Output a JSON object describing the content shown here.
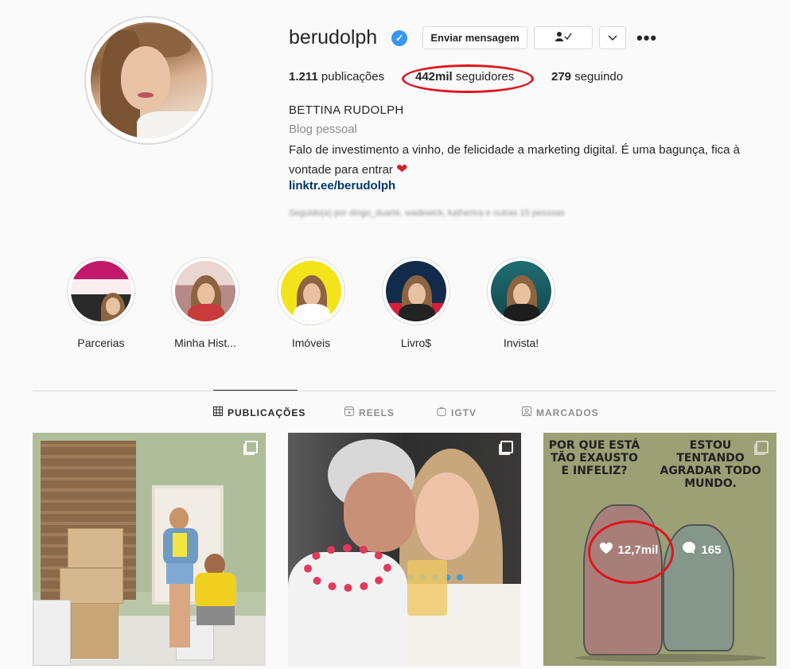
{
  "profile": {
    "username": "berudolph",
    "verified_icon": "verified-badge-icon",
    "buttons": {
      "message": "Enviar mensagem",
      "follow_icon": "person-check-icon",
      "dropdown_icon": "chevron-down-icon",
      "more_icon": "more-dots-icon"
    },
    "stats": {
      "posts_value": "1.211",
      "posts_label": "publicações",
      "followers_value": "442mil",
      "followers_label": "seguidores",
      "following_value": "279",
      "following_label": "seguindo"
    },
    "full_name": "BETTINA RUDOLPH",
    "category": "Blog pessoal",
    "bio": "Falo de investimento a vinho, de felicidade a marketing digital. É uma bagunça, fica à vontade para entrar",
    "bio_emoji": "❤",
    "link": "linktr.ee/berudolph",
    "followed_by": "Seguido(a) por diogo_duarte, wadewick, katheriva e outras 15 pessoas"
  },
  "highlights": [
    {
      "label": "Parcerias"
    },
    {
      "label": "Minha Hist..."
    },
    {
      "label": "Imóveis"
    },
    {
      "label": "Livro$"
    },
    {
      "label": "Invista!"
    }
  ],
  "tabs": [
    {
      "label": "PUBLICAÇÕES",
      "icon": "grid-icon",
      "active": true
    },
    {
      "label": "REELS",
      "icon": "reels-icon",
      "active": false
    },
    {
      "label": "IGTV",
      "icon": "igtv-icon",
      "active": false
    },
    {
      "label": "MARCADOS",
      "icon": "tagged-icon",
      "active": false
    }
  ],
  "posts": [
    {
      "type": "carousel"
    },
    {
      "type": "carousel"
    },
    {
      "type": "carousel",
      "text_left": "POR QUE ESTÁ TÃO EXAUSTO E INFELIZ?",
      "text_right": "ESTOU TENTANDO AGRADAR TODO MUNDO.",
      "likes": "12,7mil",
      "comments": "165"
    }
  ],
  "annotation_color": "#e0141e",
  "accent_link_color": "#00376b",
  "verified_color": "#3897f0"
}
